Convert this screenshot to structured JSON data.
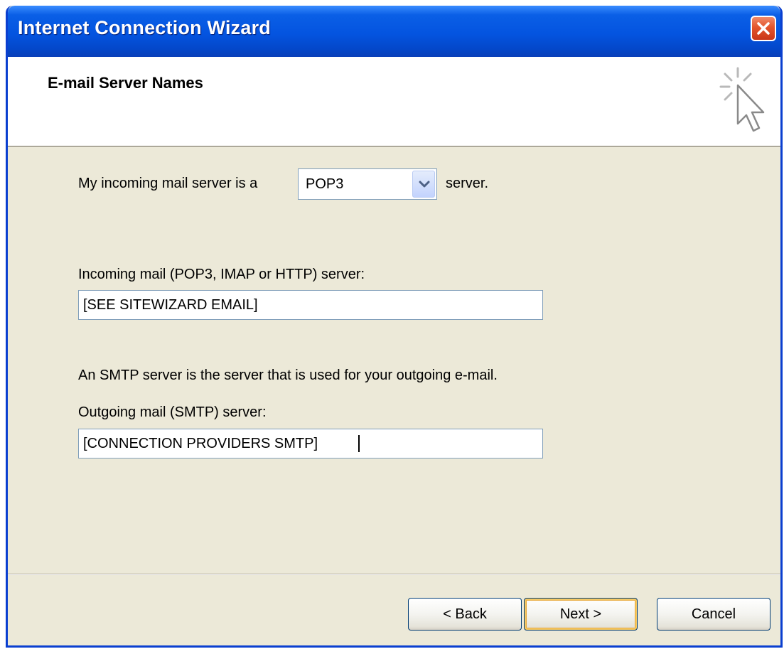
{
  "window": {
    "title": "Internet Connection Wizard",
    "close_icon": "close-icon"
  },
  "header": {
    "title": "E-mail Server Names",
    "icon": "wizard-cursor-icon"
  },
  "incoming_type": {
    "label_before": "My incoming mail server is a",
    "selected": "POP3",
    "label_after": "server."
  },
  "incoming_server": {
    "label": "Incoming mail (POP3, IMAP or HTTP) server:",
    "value": "[SEE SITEWIZARD EMAIL]"
  },
  "smtp_info": "An SMTP server is the server that is used for your outgoing e-mail.",
  "outgoing_server": {
    "label": "Outgoing mail (SMTP) server:",
    "value": "[CONNECTION PROVIDERS SMTP]"
  },
  "buttons": {
    "back": "< Back",
    "next": "Next >",
    "cancel": "Cancel"
  },
  "colors": {
    "titlebar": "#0454e0",
    "dialog_bg": "#ece9d8",
    "close_button": "#e3552c",
    "default_button_highlight": "#f5c964"
  }
}
